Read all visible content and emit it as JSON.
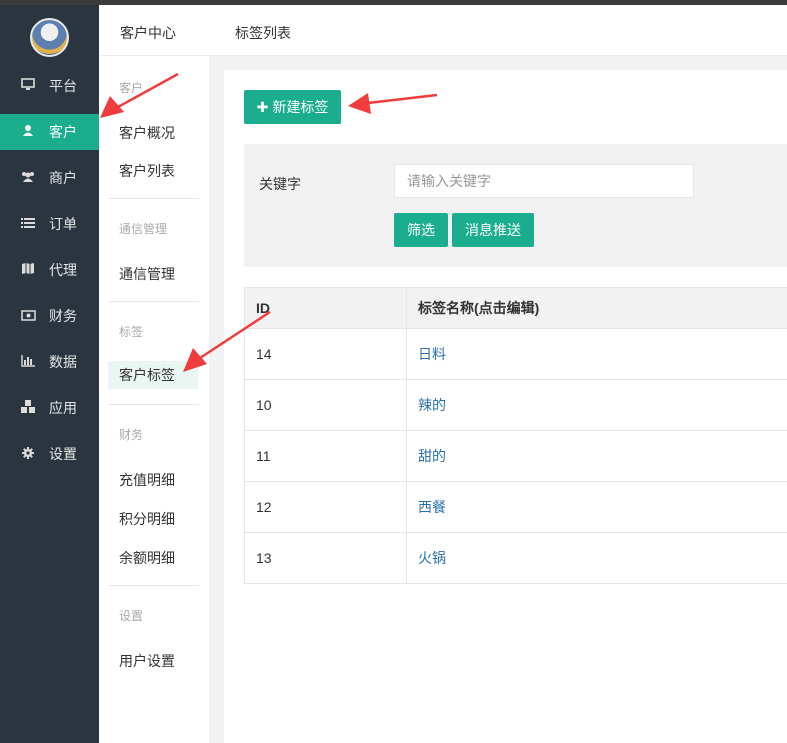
{
  "sidebar": {
    "items": [
      {
        "label": "平台",
        "icon": "monitor-icon"
      },
      {
        "label": "客户",
        "icon": "user-icon"
      },
      {
        "label": "商户",
        "icon": "users-icon"
      },
      {
        "label": "订单",
        "icon": "list-icon"
      },
      {
        "label": "代理",
        "icon": "map-icon"
      },
      {
        "label": "财务",
        "icon": "money-icon"
      },
      {
        "label": "数据",
        "icon": "bar-chart-icon"
      },
      {
        "label": "应用",
        "icon": "cubes-icon"
      },
      {
        "label": "设置",
        "icon": "gear-icon"
      }
    ],
    "active_index": 1
  },
  "subnav": {
    "groups": [
      {
        "title": "客户",
        "links": [
          "客户概况",
          "客户列表"
        ]
      },
      {
        "title": "通信管理",
        "links": [
          "通信管理"
        ]
      },
      {
        "title": "标签",
        "links": [
          "客户标签"
        ]
      },
      {
        "title": "财务",
        "links": [
          "充值明细",
          "积分明细",
          "余额明细"
        ]
      },
      {
        "title": "设置",
        "links": [
          "用户设置"
        ]
      }
    ],
    "active_link": "客户标签"
  },
  "header": {
    "crumbs": [
      "客户中心",
      "标签列表"
    ]
  },
  "main": {
    "new_tag_button": "新建标签",
    "filter": {
      "label": "关键字",
      "placeholder": "请输入关键字",
      "filter_button": "筛选",
      "push_button": "消息推送"
    },
    "table": {
      "headers": [
        "ID",
        "标签名称(点击编辑)"
      ],
      "rows": [
        {
          "id": "14",
          "name": "日料"
        },
        {
          "id": "10",
          "name": "辣的"
        },
        {
          "id": "11",
          "name": "甜的"
        },
        {
          "id": "12",
          "name": "西餐"
        },
        {
          "id": "13",
          "name": "火锅"
        }
      ]
    }
  },
  "colors": {
    "accent": "#1aae8f",
    "sidebar_bg": "#2a3540",
    "link": "#2a6fb0",
    "annotation_arrow": "#f03c3c"
  }
}
